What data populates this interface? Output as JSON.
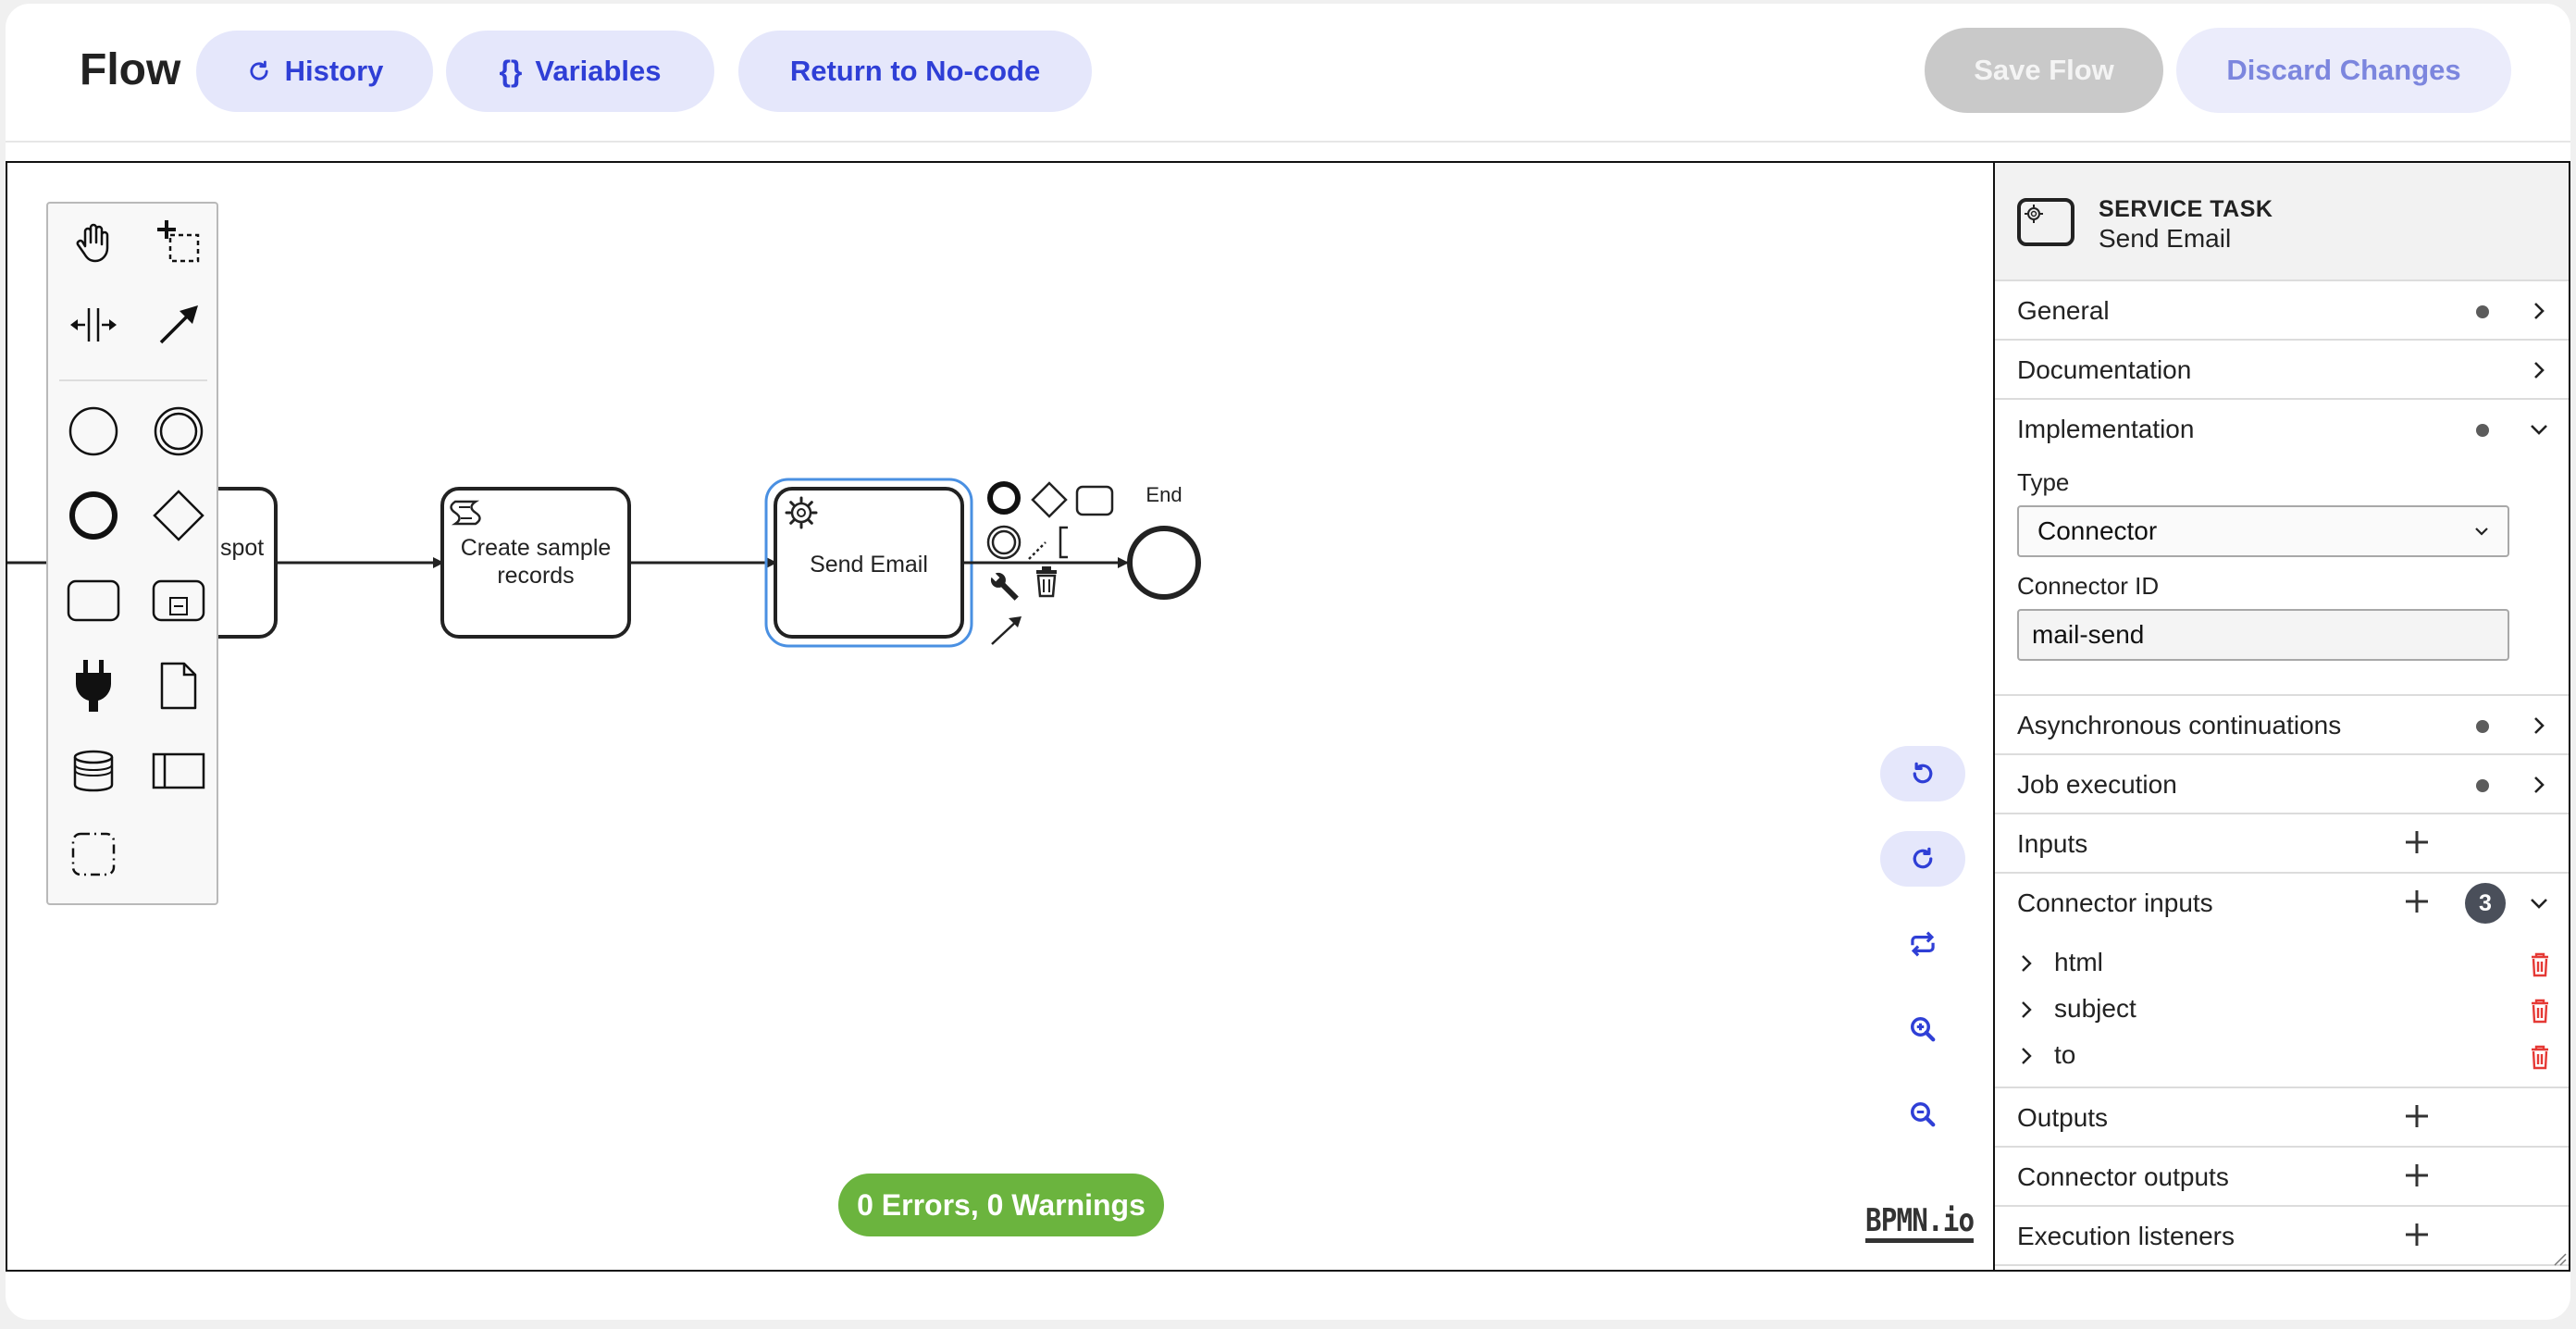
{
  "header": {
    "title": "Flow",
    "history_label": "History",
    "variables_label": "Variables",
    "no_code_label": "Return to No-code",
    "save_label": "Save Flow",
    "discard_label": "Discard Changes",
    "variables_glyph": "{}"
  },
  "diagram": {
    "tasks": [
      {
        "label": "spot"
      },
      {
        "label_line1": "Create sample",
        "label_line2": "records"
      },
      {
        "label": "Send Email"
      }
    ],
    "end_label": "End"
  },
  "status": {
    "text": "0 Errors, 0 Warnings",
    "color": "#6bb43e"
  },
  "branding": {
    "logo_text": "BPMN.io"
  },
  "panel": {
    "type": "SERVICE TASK",
    "name": "Send Email",
    "groups": {
      "general": "General",
      "documentation": "Documentation",
      "implementation": "Implementation",
      "async": "Asynchronous continuations",
      "job": "Job execution",
      "inputs": "Inputs",
      "connector_inputs": "Connector inputs",
      "connector_inputs_count": "3",
      "outputs": "Outputs",
      "connector_outputs": "Connector outputs",
      "execution_listeners": "Execution listeners"
    },
    "implementation": {
      "type_label": "Type",
      "type_value": "Connector",
      "connector_id_label": "Connector ID",
      "connector_id_value": "mail-send"
    },
    "connector_inputs": [
      "html",
      "subject",
      "to"
    ]
  },
  "colors": {
    "accent": "#2f3fd6",
    "accent_bg": "#e5e7fb",
    "selection": "#4a90e2",
    "delete": "#e53935"
  }
}
